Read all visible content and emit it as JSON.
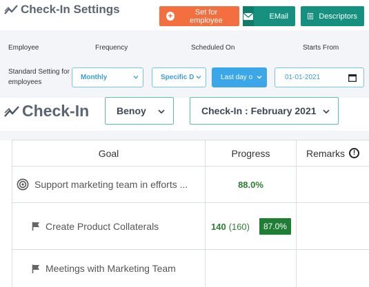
{
  "settings": {
    "title": "Check-In Settings",
    "buttons": {
      "set_for_employee": "Set for employee",
      "email": "EMail",
      "descriptors": "Descriptors"
    },
    "columns": [
      "Employee",
      "Frequency",
      "Scheduled On",
      "Starts From"
    ],
    "row_label": "Standard Setting for employees",
    "frequency": "Monthly",
    "scheduled_type": "Specific D",
    "scheduled_day": "Last day o",
    "starts_from": "01-01-2021"
  },
  "checkin": {
    "title": "Check-In",
    "employee": "Benoy",
    "period": "Check-In : February 2021"
  },
  "table": {
    "headers": {
      "goal": "Goal",
      "progress": "Progress",
      "remarks": "Remarks"
    },
    "rows": [
      {
        "goal": "Support marketing team in efforts ...",
        "progress": "88.0%"
      },
      {
        "goal": "Create Product Collaterals",
        "value": "140",
        "target": "(160)",
        "percent": "87.0%"
      },
      {
        "goal": "Meetings with Marketing Team"
      }
    ]
  },
  "colors": {
    "orange": "#f36f3f",
    "teal": "#17917f",
    "blue": "#3ba6e8",
    "green": "#2e7d32"
  }
}
